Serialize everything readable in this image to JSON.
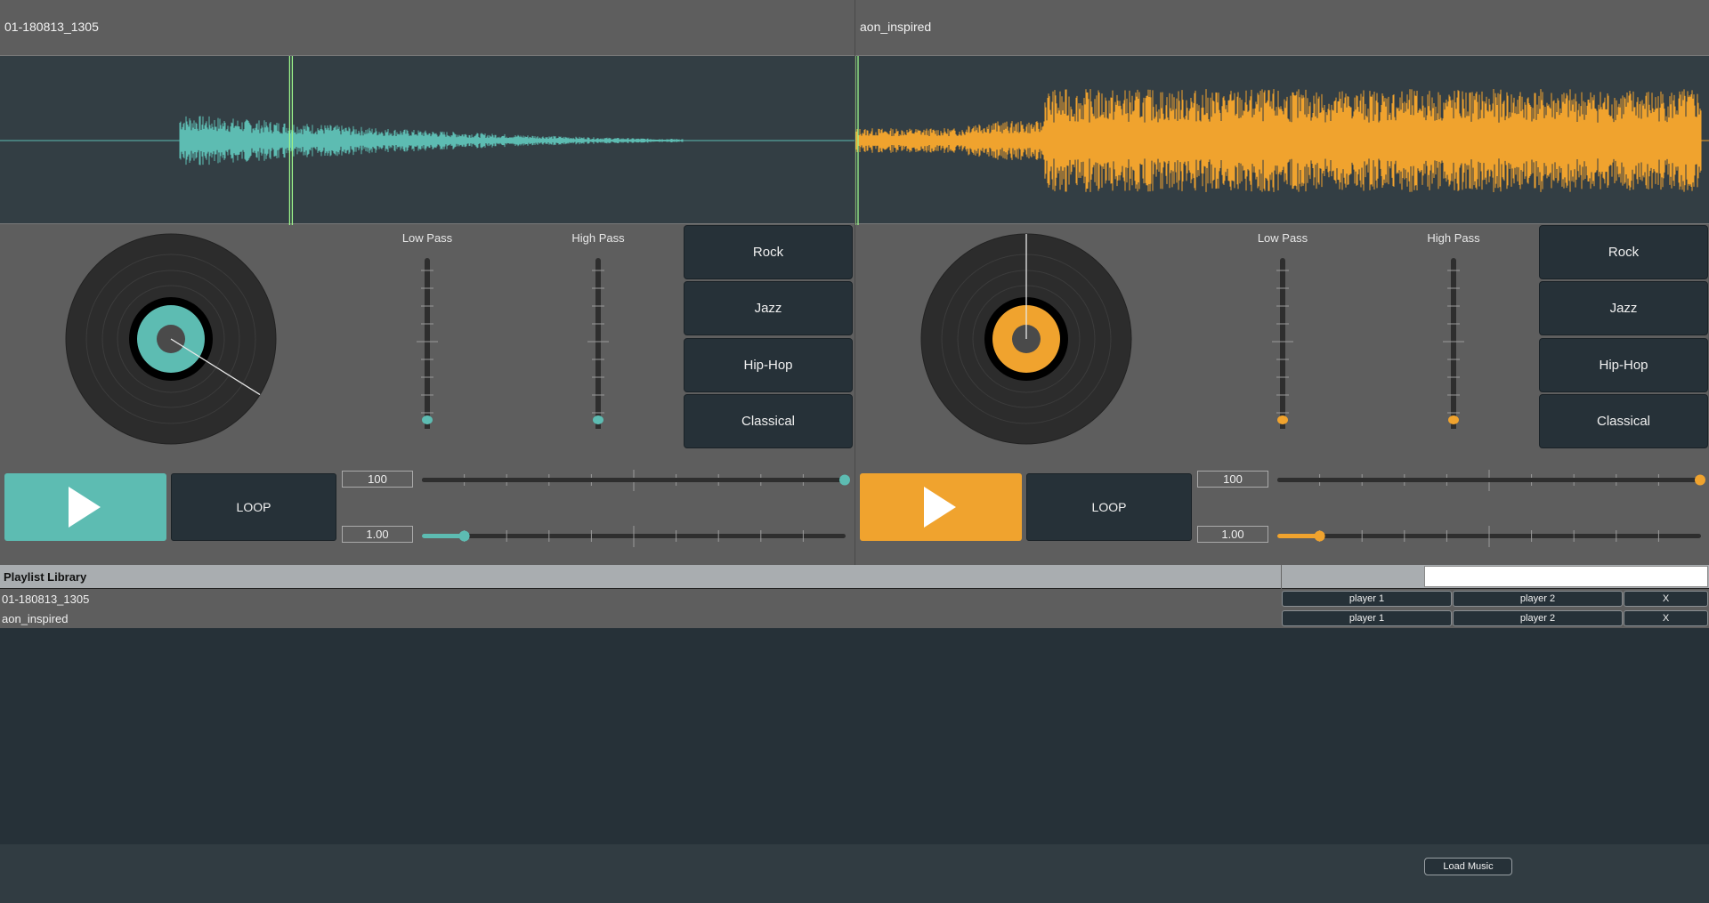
{
  "colors": {
    "deck1": "#5dbcb2",
    "deck2": "#f0a32e",
    "playhead": "#9cf58a",
    "panel": "#263138"
  },
  "decks": [
    {
      "title": "01-180813_1305",
      "filters": {
        "low_label": "Low Pass",
        "high_label": "High Pass",
        "low_value": 0,
        "high_value": 0
      },
      "genres": [
        "Rock",
        "Jazz",
        "Hip-Hop",
        "Classical"
      ],
      "play_icon": "play-icon",
      "loop_label": "LOOP",
      "volume_value": "100",
      "speed_value": "1.00",
      "volume_level": 1.0,
      "speed_level": 0.1,
      "playhead_position": 0.34
    },
    {
      "title": "aon_inspired",
      "filters": {
        "low_label": "Low Pass",
        "high_label": "High Pass",
        "low_value": 0,
        "high_value": 0
      },
      "genres": [
        "Rock",
        "Jazz",
        "Hip-Hop",
        "Classical"
      ],
      "play_icon": "play-icon",
      "loop_label": "LOOP",
      "volume_value": "100",
      "speed_value": "1.00",
      "volume_level": 1.0,
      "speed_level": 0.1,
      "playhead_position": 0.0
    }
  ],
  "library": {
    "title": "Playlist Library",
    "search_value": "",
    "tracks": [
      {
        "name": "01-180813_1305",
        "player1": "player 1",
        "player2": "player 2",
        "remove": "X"
      },
      {
        "name": "aon_inspired",
        "player1": "player 1",
        "player2": "player 2",
        "remove": "X"
      }
    ]
  },
  "footer": {
    "load_label": "Load Music"
  }
}
